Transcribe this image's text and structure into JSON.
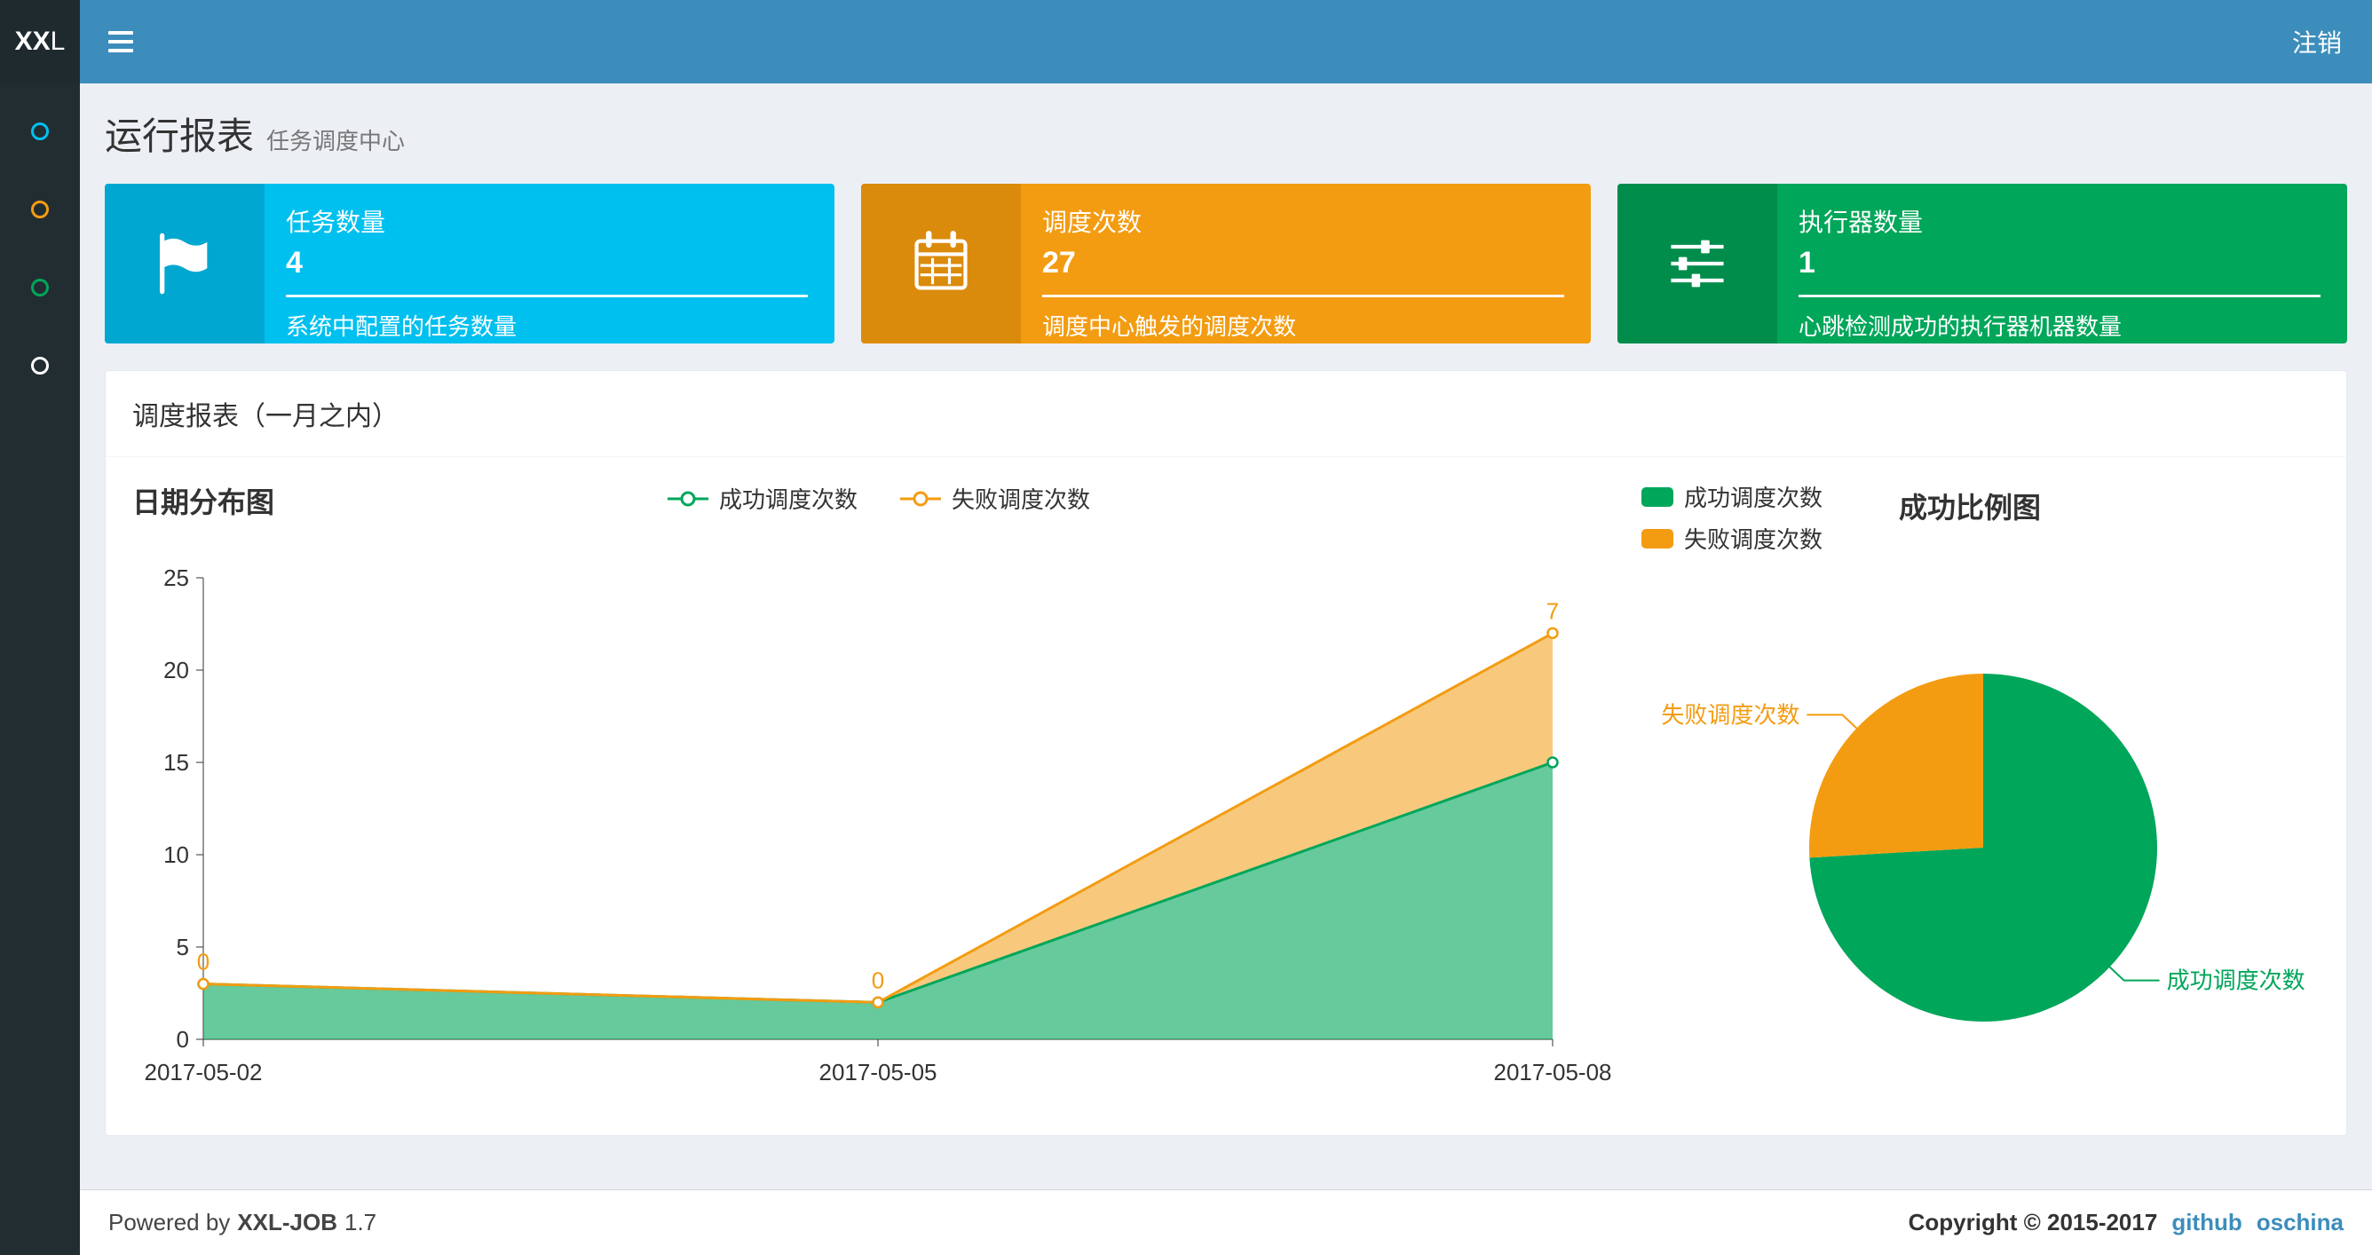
{
  "navbar": {
    "logo_bold": "XX",
    "logo_light": "L",
    "logout_label": "注销"
  },
  "sidebar": {
    "items": [
      {
        "icon": "circle-outline-icon",
        "icon_color": "#00c0ef"
      },
      {
        "icon": "circle-outline-icon",
        "icon_color": "#f39c12"
      },
      {
        "icon": "circle-outline-icon",
        "icon_color": "#00a65a"
      },
      {
        "icon": "circle-outline-icon",
        "icon_color": "#ffffff"
      }
    ]
  },
  "page_header": {
    "title": "运行报表",
    "subtitle": "任务调度中心"
  },
  "info_boxes": [
    {
      "icon": "flag-icon",
      "title": "任务数量",
      "value": "4",
      "description": "系统中配置的任务数量",
      "bg": "#00c0ef",
      "icon_bg": "#00a7d0"
    },
    {
      "icon": "calendar-icon",
      "title": "调度次数",
      "value": "27",
      "description": "调度中心触发的调度次数",
      "bg": "#f39c12",
      "icon_bg": "#db8b0b"
    },
    {
      "icon": "sliders-icon",
      "title": "执行器数量",
      "value": "1",
      "description": "心跳检测成功的执行器机器数量",
      "bg": "#00a65a",
      "icon_bg": "#008d4c"
    }
  ],
  "panel": {
    "title": "调度报表（一月之内）"
  },
  "chart_data": [
    {
      "type": "area",
      "title": "日期分布图",
      "stacked": true,
      "x": [
        "2017-05-02",
        "2017-05-05",
        "2017-05-08"
      ],
      "series": [
        {
          "name": "成功调度次数",
          "color": "#00a65a",
          "values": [
            3,
            2,
            15
          ]
        },
        {
          "name": "失败调度次数",
          "color": "#f39c12",
          "values": [
            0,
            0,
            7
          ],
          "point_labels": [
            "0",
            "0",
            "7"
          ]
        }
      ],
      "ylim": [
        0,
        25
      ],
      "yticks": [
        0,
        5,
        10,
        15,
        20,
        25
      ],
      "legend": [
        "成功调度次数",
        "失败调度次数"
      ],
      "legend_position": "top-center",
      "grid": false
    },
    {
      "type": "pie",
      "title": "成功比例图",
      "slices": [
        {
          "name": "成功调度次数",
          "value": 20,
          "color": "#00a65a"
        },
        {
          "name": "失败调度次数",
          "value": 7,
          "color": "#f39c12"
        }
      ],
      "legend": [
        "成功调度次数",
        "失败调度次数"
      ],
      "legend_position": "top-left"
    }
  ],
  "footer": {
    "powered_prefix": "Powered by",
    "product": "XXL-JOB",
    "version": "1.7",
    "copyright": "Copyright © 2015-2017",
    "links": [
      {
        "label": "github"
      },
      {
        "label": "oschina"
      }
    ]
  }
}
